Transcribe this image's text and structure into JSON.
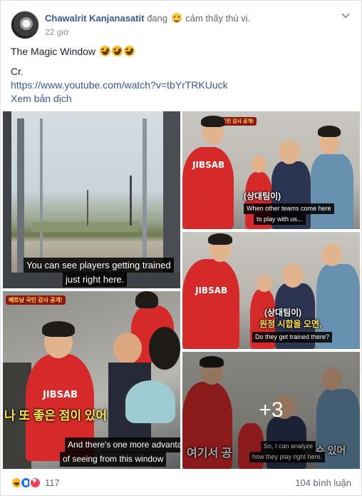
{
  "post": {
    "author": "Chawalrit Kanjanasatit",
    "feeling_prefix": "đang",
    "feeling_emoji": "slightly-smiling-emoji",
    "feeling_text": "cảm thấy thú vị.",
    "timestamp": "22 giờ",
    "title": "The Magic Window",
    "title_emojis": [
      "laughing-emoji",
      "laughing-emoji",
      "laughing-emoji"
    ],
    "credit": "Cr.",
    "link": "https://www.youtube.com/watch?v=tbYrTRKUuck",
    "translate": "Xem bản dịch"
  },
  "photos": {
    "p1_caption_l1": "You can see players getting trained",
    "p1_caption_l2": "just right here.",
    "p2_badge": "베트남 국민 감사 공개!",
    "p2_korean": "나 또 좋은 점이 있어",
    "p2_caption_l1": "And there's one more advanta",
    "p2_caption_l2": "of seeing from this window",
    "p2_jersey": "JIBSAB",
    "p3_korean": "(상대팀이)",
    "p3_caption_l1": "When other teams come here",
    "p3_caption_l2": "to play with us...",
    "p3_jersey": "JIBSAB",
    "p4_korean_l1": "(상대팀이)",
    "p4_korean_l2": "원정 시합을 오면,",
    "p4_caption": "Do they get trained there?",
    "p4_jersey": "JIBSAB",
    "p5_korean": "여기서 공",
    "p5_korean_end": "할 수 있어",
    "p5_caption_l1": "So, I can analyze",
    "p5_caption_l2": "how they play right here.",
    "more_count": "+3"
  },
  "footer": {
    "reactions": [
      "haha",
      "like",
      "love"
    ],
    "reaction_count": "117",
    "comments": "104 bình luận"
  },
  "colors": {
    "link": "#385898",
    "secondary_text": "#90949c",
    "like_blue": "#1877f2",
    "love_red": "#f33e58",
    "haha_yellow": "#f7b928",
    "jersey_red": "#d62a2a"
  }
}
